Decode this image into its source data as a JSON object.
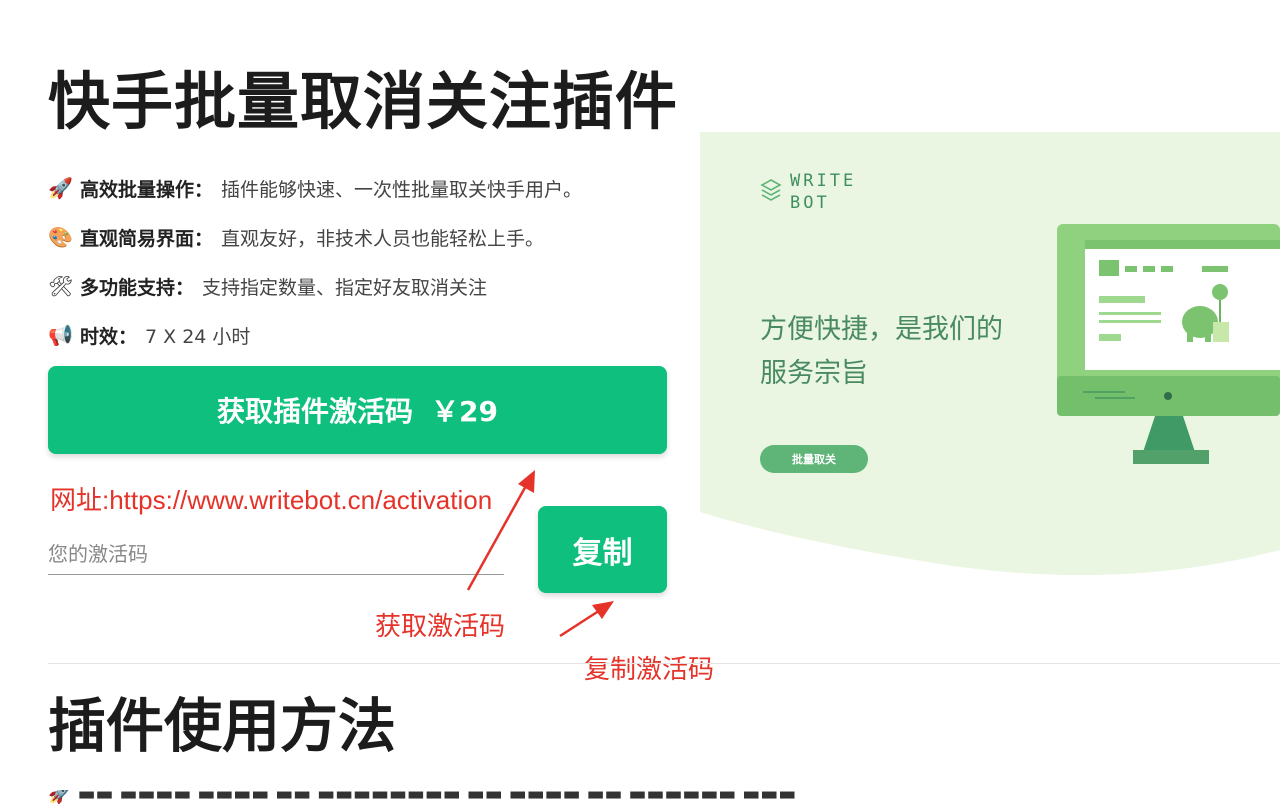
{
  "page": {
    "title": "快手批量取消关注插件",
    "features": [
      {
        "icon": "rocket-icon",
        "emoji": "🚀",
        "key": "高效批量操作：",
        "value": "插件能够快速、一次性批量取关快手用户。"
      },
      {
        "icon": "palette-icon",
        "emoji": "🎨",
        "key": "直观简易界面：",
        "value": "直观友好，非技术人员也能轻松上手。"
      },
      {
        "icon": "tools-icon",
        "emoji": "🛠",
        "key": "多功能支持：",
        "value": "支持指定数量、指定好友取消关注"
      },
      {
        "icon": "megaphone-icon",
        "emoji": "📢",
        "key": "时效：",
        "value": "7 X 24 小时"
      }
    ],
    "buy_button": {
      "label": "获取插件激活码",
      "price": "￥29"
    },
    "url_note": "网址:https://www.writebot.cn/activation",
    "activation_input": {
      "placeholder": "您的激活码",
      "value": ""
    },
    "copy_button": {
      "label": "复制"
    },
    "annotations": {
      "get_code": "获取激活码",
      "copy_code": "复制激活码"
    },
    "usage_title": "插件使用方法"
  },
  "promo": {
    "logo_text": "WRITE BOT",
    "slogan": "方便快捷，是我们的服务宗旨",
    "button_label": "批量取关"
  },
  "colors": {
    "accent_green": "#0fbf7e",
    "annotation_red": "#e5332a",
    "promo_bg": "#eaf6e2",
    "promo_green": "#5eb577"
  }
}
